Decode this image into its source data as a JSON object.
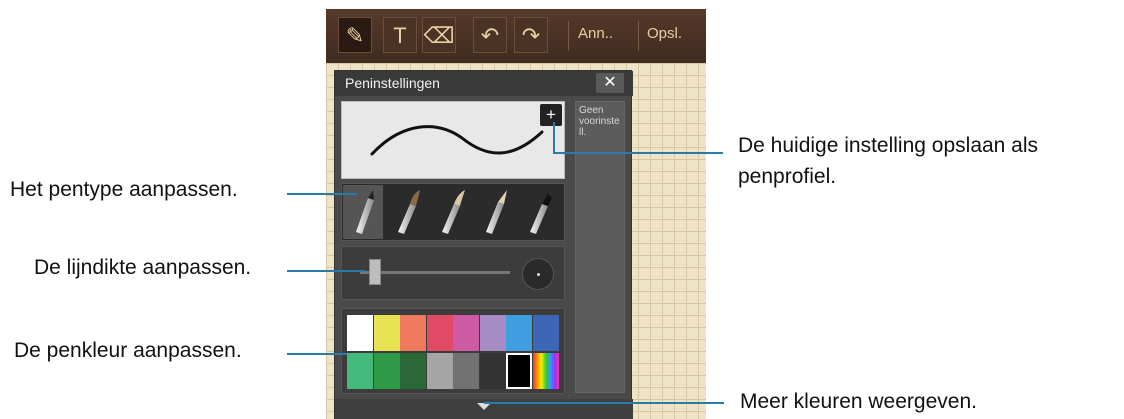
{
  "toolbar": {
    "pen_icon": "✎",
    "text_icon": "T",
    "eraser_icon": "⌫",
    "undo_icon": "↶",
    "redo_icon": "↷",
    "annuleren_label": "Ann..",
    "opslaan_label": "Opsl."
  },
  "panel": {
    "title": "Peninstellingen",
    "close": "✕",
    "add": "+",
    "preset_label": "Geen voorinste ll."
  },
  "slider": {
    "value_fraction": 0.1
  },
  "palette": {
    "row1": [
      "#ffffff",
      "#e8e353",
      "#f07a5e",
      "#e14a64",
      "#cc5ba4",
      "#a58cc4",
      "#3f9ee0",
      "#3d66b4"
    ],
    "row2": [
      "#43b97c",
      "#2e9a48",
      "#2a6838",
      "#a5a5a5",
      "#727272",
      "#333333",
      "#000000",
      "rainbow"
    ]
  },
  "callouts": {
    "save_profile_line1": "De huidige instelling opslaan als",
    "save_profile_line2": "penprofiel.",
    "pen_type": "Het pentype aanpassen.",
    "thickness": "De lijndikte aanpassen.",
    "pen_color": "De penkleur aanpassen.",
    "more_colors": "Meer kleuren weergeven."
  },
  "colors": {
    "callout_line": "#2a7ca8",
    "toolbar_bg": "#4b3326",
    "panel_bg": "#4a4a4a"
  }
}
